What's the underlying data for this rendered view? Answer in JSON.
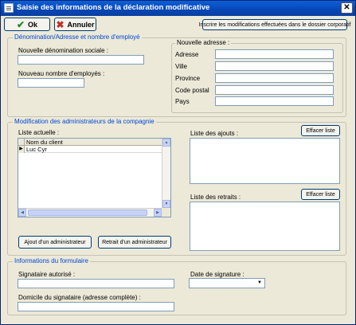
{
  "window": {
    "title": "Saisie des informations de la déclaration modificative",
    "close_glyph": "✕"
  },
  "toolbar": {
    "ok_label": "Ok",
    "cancel_label": "Annuler",
    "register_label": "Inscrire les modifications effectuées dans le dossier corporatif"
  },
  "identity": {
    "legend": "Dénomination/Adresse et nombre d'employé",
    "new_name_label": "Nouvelle dénomination sociale :",
    "new_name_value": "",
    "employees_label": "Nouveau nombre d'employés :",
    "employees_value": ""
  },
  "address": {
    "legend": "Nouvelle adresse :",
    "fields": [
      {
        "label": "Adresse",
        "value": ""
      },
      {
        "label": "Ville",
        "value": ""
      },
      {
        "label": "Province",
        "value": ""
      },
      {
        "label": "Code postal",
        "value": ""
      },
      {
        "label": "Pays",
        "value": ""
      }
    ]
  },
  "admins": {
    "legend": "Modification des administrateurs de la compagnie",
    "current_list_label": "Liste actuelle  :",
    "grid_column": "Nom du client",
    "rows": [
      {
        "name": "Luc Cyr",
        "selected": true
      }
    ],
    "row_indicator_glyph": "▶",
    "add_button": "Ajout d'un administrateur",
    "remove_button": "Retrait d'un administrateur",
    "additions_label": "Liste des ajouts :",
    "additions_clear": "Effacer liste",
    "removals_label": "Liste des retraits :",
    "removals_clear": "Effacer liste"
  },
  "form_info": {
    "legend": "Informations du formulaire",
    "signatory_label": "Signataire autorisé :",
    "signatory_value": "",
    "signature_date_label": "Date de signature :",
    "signature_date_value": "",
    "domicile_label": "Domicile du signataire (adresse complète) :",
    "domicile_value": ""
  },
  "colors": {
    "title_bar": "#0846b8",
    "window_bg": "#ece9d8",
    "legend_text": "#0046d5",
    "field_border": "#7f9db9"
  },
  "icons": {
    "ok": "check-icon",
    "cancel": "x-icon",
    "close": "close-icon",
    "dropdown": "chevron-down-icon"
  }
}
